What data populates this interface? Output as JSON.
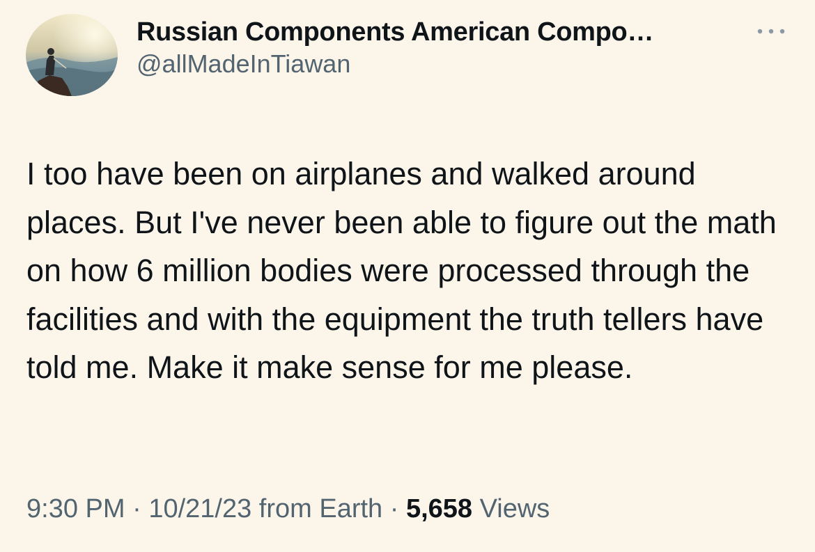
{
  "author": {
    "display_name": "Russian Components American Compo…",
    "handle": "@allMadeInTiawan"
  },
  "tweet": {
    "text": "I too have been on airplanes and walked around places. But I've never been able to figure out the math on how 6 million bodies were processed through the facilities and with the equipment the truth tellers have told me. Make it make sense for me please."
  },
  "meta": {
    "time": "9:30 PM",
    "separator": "·",
    "date": "10/21/23",
    "source": "from Earth",
    "views_count": "5,658",
    "views_label": "Views"
  },
  "icons": {
    "more": "more-horizontal-icon",
    "avatar": "avatar-image"
  },
  "colors": {
    "background": "#fcf5ea",
    "text_primary": "#0f1419",
    "text_secondary": "#536471"
  }
}
